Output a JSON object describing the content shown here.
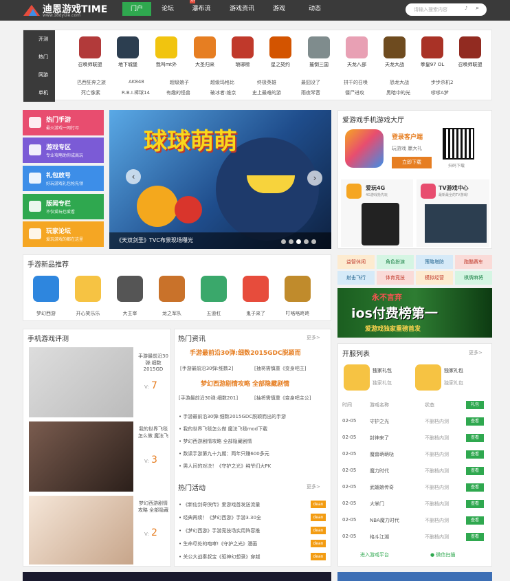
{
  "brand": {
    "name": "迪恩游戏TIME",
    "domain": "www.18dyule.com"
  },
  "nav": [
    "门户",
    "论坛",
    "瀑布流",
    "游戏资讯",
    "游戏",
    "动态"
  ],
  "nav_badge": "热",
  "search": {
    "placeholder": "请输入搜索内容"
  },
  "tabs": [
    "开测",
    "热门",
    "网游",
    "单机"
  ],
  "games": [
    "召唤师联盟",
    "地下城堡",
    "我叫mt外",
    "大圣归来",
    "琅琊榜",
    "星之契约",
    "摧倒三国",
    "天龙八部",
    "天龙大战",
    "拳皇97 OL",
    "召唤师联盟"
  ],
  "links1": [
    "巴西狂奔之旅",
    "AK848",
    "超级娘子",
    "超级玛格比",
    "终极英雄",
    "最囧没了",
    "拼千的召唤",
    "恐龙大战",
    "步步杀机2"
  ],
  "links2": [
    "死亡像素",
    "R.B.I.棒球14",
    "有趣的怪兽",
    "破冰者:维京",
    "史上最难的游",
    "雨夜琴音",
    "僵尸进攻",
    "黑暗中的光",
    "嗲嗲A梦"
  ],
  "cards": [
    {
      "t": "热门手游",
      "s": "最火游戏一网打尽",
      "c": "#e84d6f"
    },
    {
      "t": "游戏专区",
      "s": "专业攻略助你成高玩",
      "c": "#7b5bd6"
    },
    {
      "t": "礼包放号",
      "s": "好玩游戏礼包抢先领",
      "c": "#3d8ee8"
    },
    {
      "t": "版闻专栏",
      "s": "不仅爱玩也爱看",
      "c": "#2fa84f"
    },
    {
      "t": "玩家论坛",
      "s": "爱玩游戏的都在这里",
      "c": "#f5a623"
    }
  ],
  "banner": {
    "title": "球球萌萌",
    "caption": "《天双剑圣》TVC布景现场曝光"
  },
  "mobile": {
    "title": "爱游戏手机游戏大厅",
    "login": "登录客户端",
    "tagline": "玩游戏 赢大礼",
    "download": "立即下载",
    "scan": "扫码下载",
    "app1": "爱玩4G",
    "app1_sub": "4G游戏抢先玩",
    "app2": "TV游戏中心",
    "app2_sub": "最新最全的TV游戏！"
  },
  "newgames": {
    "title": "手游新品推荐",
    "items": [
      "梦幻西游",
      "开心笑乐乐",
      "大主宰",
      "龙之军队",
      "五道杠",
      "鬼子来了",
      "叮咯咯咚咚"
    ]
  },
  "cats": [
    "益智休闲",
    "角色扮演",
    "策略塔防",
    "跑酷赛车",
    "射击飞行",
    "体育竞技",
    "模拟经营",
    "棋牌麻将"
  ],
  "ad": {
    "line1": "永不言弃",
    "line2": "ios付费榜第一",
    "line3": "爱游戏独家重磅首发"
  },
  "review": {
    "title": "手机游戏评测",
    "items": [
      {
        "t": "手游最前沿30弹:细数2015GD",
        "v": "V:",
        "n": "7"
      },
      {
        "t": "我的世界飞毯怎么做 魔法飞",
        "v": "V:",
        "n": "3"
      },
      {
        "t": "梦幻西游剧情攻略 全部隐藏",
        "v": "V:",
        "n": "2"
      }
    ]
  },
  "news": {
    "title": "热门资讯",
    "more": "更多>",
    "h1": "手游最前沿30弹:细数2015GDC脱颖而",
    "s1a": "[手游最前沿30弹:细数2]",
    "s1b": "[抽将需慎重《变身吧主]",
    "h2": "梦幻西游剧情攻略 全部隐藏剧情",
    "s2a": "[手游最前沿30弹:细数201]",
    "s2b": "[抽将需慎重《变身吧主公]",
    "list": [
      "手游最前沿30弹:细数2015GDC脱颖而出的手游",
      "我的世界飞毯怎么做 魔法飞毯mod下载",
      "梦幻西游剧情攻略 全部隐藏剧情",
      "数读手游第九十九期：两年只赚600多元",
      "男人间的对决！《守护之光》纯爷们大PK"
    ]
  },
  "acts": {
    "title": "热门活动",
    "more": "更多>",
    "tag": "dean",
    "list": [
      "《新仙剑奇侠传》爱游戏首发送流量",
      "经典再续！《梦幻西游》手游3.30全",
      "《梦幻西游》手游竞技场实用阵容推",
      "生命尽处的咆哮!《守护之光》漫画",
      "关公大战秦叔宝《驱神幻想录》穿越"
    ]
  },
  "server": {
    "title": "开服列表",
    "more": "更多>",
    "gift": "独家礼包",
    "gift_sub": "独家礼包",
    "cols": [
      "时间",
      "游戏名称",
      "状态",
      "礼包"
    ],
    "check": "查看",
    "rows": [
      [
        "02-05",
        "守护之光",
        "不删档内测"
      ],
      [
        "02-05",
        "封神来了",
        "不删档内测"
      ],
      [
        "02-05",
        "魔兽萌萌哒",
        "不删档内测"
      ],
      [
        "02-05",
        "魔力时代",
        "不删档内测"
      ],
      [
        "02-05",
        "武媚娘传奇",
        "不删档内测"
      ],
      [
        "02-05",
        "大掌门",
        "不删档内测"
      ],
      [
        "02-05",
        "NBA魔力时代",
        "不删档内测"
      ],
      [
        "02-05",
        "格斗江湖",
        "不删档内测"
      ]
    ],
    "enter": "进入游戏平台",
    "wx": "微信扫描"
  }
}
